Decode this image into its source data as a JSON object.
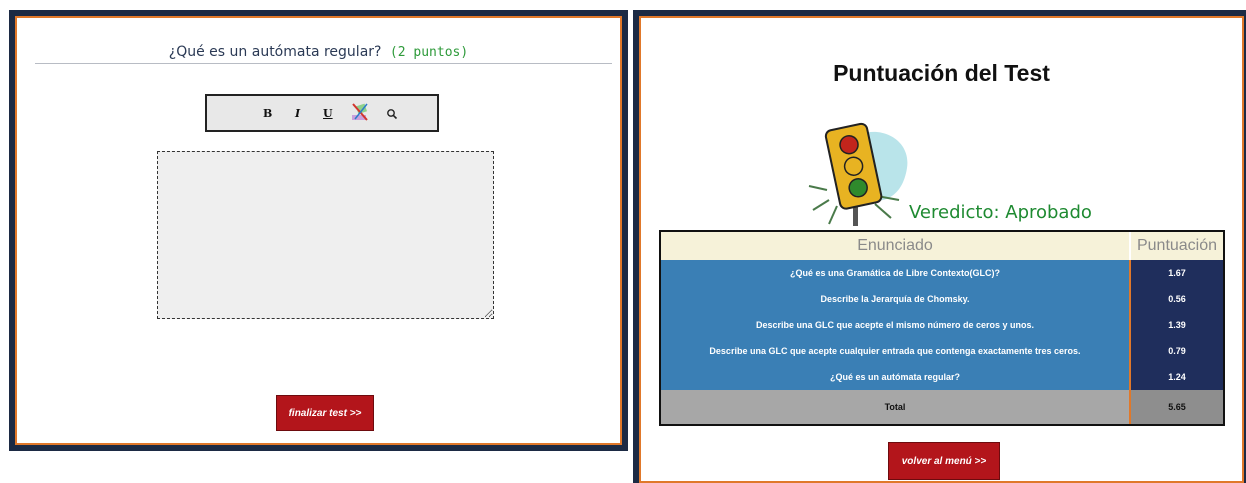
{
  "test_screen": {
    "question_text": "¿Qué es un autómata regular?",
    "question_points": "(2 puntos)",
    "toolbar": {
      "bold_label": "B",
      "italic_label": "I",
      "underline_label": "U",
      "format_icon": "format-paint-icon",
      "search_icon": "search-icon"
    },
    "answer_value": "",
    "finish_button_label": "finalizar test >>"
  },
  "score_screen": {
    "title": "Puntuación del Test",
    "verdict": "Veredicto: Aprobado",
    "table": {
      "headers": [
        "Enunciado",
        "Puntuación"
      ],
      "rows": [
        {
          "question": "¿Qué es una Gramática de Libre Contexto(GLC)?",
          "score": "1.67"
        },
        {
          "question": "Describe la Jerarquía de Chomsky.",
          "score": "0.56"
        },
        {
          "question": "Describe una GLC que acepte el mismo número de ceros y unos.",
          "score": "1.39"
        },
        {
          "question": "Describe una GLC que acepte cualquier entrada que contenga exactamente tres ceros.",
          "score": "0.79"
        },
        {
          "question": "¿Qué es un autómata regular?",
          "score": "1.24"
        }
      ],
      "total_label": "Total",
      "total_score": "5.65"
    },
    "back_button_label": "volver al menú >>"
  },
  "colors": {
    "frame": "#1c2a44",
    "frame_accent": "#e0782a",
    "button_red": "#b3151b",
    "verdict_green": "#1e8a31",
    "row_blue": "#3a7fb5",
    "score_navy": "#1f2e5c"
  }
}
